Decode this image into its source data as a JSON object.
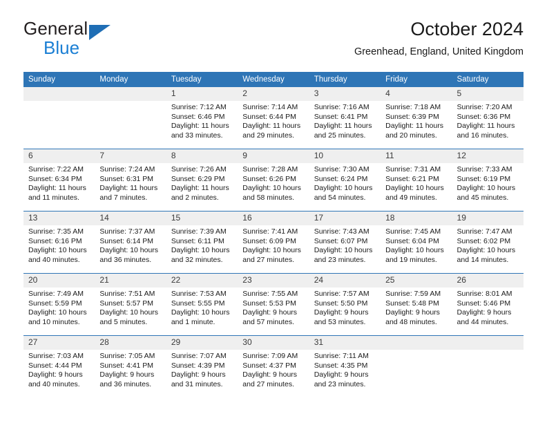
{
  "brand": {
    "name_part1": "General",
    "name_part2": "Blue",
    "triangle_icon": "triangle-icon",
    "accent_blue": "#1b7fd4",
    "logo_dark": "#231f20"
  },
  "header": {
    "title": "October 2024",
    "subtitle": "Greenhead, England, United Kingdom"
  },
  "calendar": {
    "header_bg": "#2e75b6",
    "daynum_bg": "#efefef",
    "weekdays": [
      "Sunday",
      "Monday",
      "Tuesday",
      "Wednesday",
      "Thursday",
      "Friday",
      "Saturday"
    ],
    "weeks": [
      [
        {
          "day": "",
          "sunrise": "",
          "sunset": "",
          "daylight": ""
        },
        {
          "day": "",
          "sunrise": "",
          "sunset": "",
          "daylight": ""
        },
        {
          "day": "1",
          "sunrise": "Sunrise: 7:12 AM",
          "sunset": "Sunset: 6:46 PM",
          "daylight": "Daylight: 11 hours and 33 minutes."
        },
        {
          "day": "2",
          "sunrise": "Sunrise: 7:14 AM",
          "sunset": "Sunset: 6:44 PM",
          "daylight": "Daylight: 11 hours and 29 minutes."
        },
        {
          "day": "3",
          "sunrise": "Sunrise: 7:16 AM",
          "sunset": "Sunset: 6:41 PM",
          "daylight": "Daylight: 11 hours and 25 minutes."
        },
        {
          "day": "4",
          "sunrise": "Sunrise: 7:18 AM",
          "sunset": "Sunset: 6:39 PM",
          "daylight": "Daylight: 11 hours and 20 minutes."
        },
        {
          "day": "5",
          "sunrise": "Sunrise: 7:20 AM",
          "sunset": "Sunset: 6:36 PM",
          "daylight": "Daylight: 11 hours and 16 minutes."
        }
      ],
      [
        {
          "day": "6",
          "sunrise": "Sunrise: 7:22 AM",
          "sunset": "Sunset: 6:34 PM",
          "daylight": "Daylight: 11 hours and 11 minutes."
        },
        {
          "day": "7",
          "sunrise": "Sunrise: 7:24 AM",
          "sunset": "Sunset: 6:31 PM",
          "daylight": "Daylight: 11 hours and 7 minutes."
        },
        {
          "day": "8",
          "sunrise": "Sunrise: 7:26 AM",
          "sunset": "Sunset: 6:29 PM",
          "daylight": "Daylight: 11 hours and 2 minutes."
        },
        {
          "day": "9",
          "sunrise": "Sunrise: 7:28 AM",
          "sunset": "Sunset: 6:26 PM",
          "daylight": "Daylight: 10 hours and 58 minutes."
        },
        {
          "day": "10",
          "sunrise": "Sunrise: 7:30 AM",
          "sunset": "Sunset: 6:24 PM",
          "daylight": "Daylight: 10 hours and 54 minutes."
        },
        {
          "day": "11",
          "sunrise": "Sunrise: 7:31 AM",
          "sunset": "Sunset: 6:21 PM",
          "daylight": "Daylight: 10 hours and 49 minutes."
        },
        {
          "day": "12",
          "sunrise": "Sunrise: 7:33 AM",
          "sunset": "Sunset: 6:19 PM",
          "daylight": "Daylight: 10 hours and 45 minutes."
        }
      ],
      [
        {
          "day": "13",
          "sunrise": "Sunrise: 7:35 AM",
          "sunset": "Sunset: 6:16 PM",
          "daylight": "Daylight: 10 hours and 40 minutes."
        },
        {
          "day": "14",
          "sunrise": "Sunrise: 7:37 AM",
          "sunset": "Sunset: 6:14 PM",
          "daylight": "Daylight: 10 hours and 36 minutes."
        },
        {
          "day": "15",
          "sunrise": "Sunrise: 7:39 AM",
          "sunset": "Sunset: 6:11 PM",
          "daylight": "Daylight: 10 hours and 32 minutes."
        },
        {
          "day": "16",
          "sunrise": "Sunrise: 7:41 AM",
          "sunset": "Sunset: 6:09 PM",
          "daylight": "Daylight: 10 hours and 27 minutes."
        },
        {
          "day": "17",
          "sunrise": "Sunrise: 7:43 AM",
          "sunset": "Sunset: 6:07 PM",
          "daylight": "Daylight: 10 hours and 23 minutes."
        },
        {
          "day": "18",
          "sunrise": "Sunrise: 7:45 AM",
          "sunset": "Sunset: 6:04 PM",
          "daylight": "Daylight: 10 hours and 19 minutes."
        },
        {
          "day": "19",
          "sunrise": "Sunrise: 7:47 AM",
          "sunset": "Sunset: 6:02 PM",
          "daylight": "Daylight: 10 hours and 14 minutes."
        }
      ],
      [
        {
          "day": "20",
          "sunrise": "Sunrise: 7:49 AM",
          "sunset": "Sunset: 5:59 PM",
          "daylight": "Daylight: 10 hours and 10 minutes."
        },
        {
          "day": "21",
          "sunrise": "Sunrise: 7:51 AM",
          "sunset": "Sunset: 5:57 PM",
          "daylight": "Daylight: 10 hours and 5 minutes."
        },
        {
          "day": "22",
          "sunrise": "Sunrise: 7:53 AM",
          "sunset": "Sunset: 5:55 PM",
          "daylight": "Daylight: 10 hours and 1 minute."
        },
        {
          "day": "23",
          "sunrise": "Sunrise: 7:55 AM",
          "sunset": "Sunset: 5:53 PM",
          "daylight": "Daylight: 9 hours and 57 minutes."
        },
        {
          "day": "24",
          "sunrise": "Sunrise: 7:57 AM",
          "sunset": "Sunset: 5:50 PM",
          "daylight": "Daylight: 9 hours and 53 minutes."
        },
        {
          "day": "25",
          "sunrise": "Sunrise: 7:59 AM",
          "sunset": "Sunset: 5:48 PM",
          "daylight": "Daylight: 9 hours and 48 minutes."
        },
        {
          "day": "26",
          "sunrise": "Sunrise: 8:01 AM",
          "sunset": "Sunset: 5:46 PM",
          "daylight": "Daylight: 9 hours and 44 minutes."
        }
      ],
      [
        {
          "day": "27",
          "sunrise": "Sunrise: 7:03 AM",
          "sunset": "Sunset: 4:44 PM",
          "daylight": "Daylight: 9 hours and 40 minutes."
        },
        {
          "day": "28",
          "sunrise": "Sunrise: 7:05 AM",
          "sunset": "Sunset: 4:41 PM",
          "daylight": "Daylight: 9 hours and 36 minutes."
        },
        {
          "day": "29",
          "sunrise": "Sunrise: 7:07 AM",
          "sunset": "Sunset: 4:39 PM",
          "daylight": "Daylight: 9 hours and 31 minutes."
        },
        {
          "day": "30",
          "sunrise": "Sunrise: 7:09 AM",
          "sunset": "Sunset: 4:37 PM",
          "daylight": "Daylight: 9 hours and 27 minutes."
        },
        {
          "day": "31",
          "sunrise": "Sunrise: 7:11 AM",
          "sunset": "Sunset: 4:35 PM",
          "daylight": "Daylight: 9 hours and 23 minutes."
        },
        {
          "day": "",
          "sunrise": "",
          "sunset": "",
          "daylight": ""
        },
        {
          "day": "",
          "sunrise": "",
          "sunset": "",
          "daylight": ""
        }
      ]
    ]
  }
}
